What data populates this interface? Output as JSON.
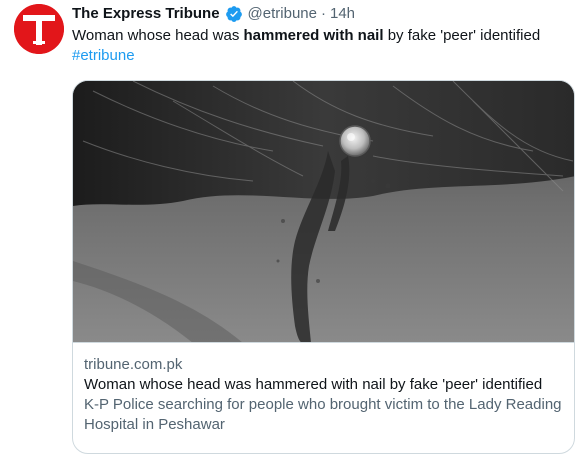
{
  "tweet": {
    "author": {
      "display_name": "The Express Tribune",
      "handle": "@etribune",
      "verified": true,
      "avatar_letter": "T",
      "avatar_color": "#e2161a"
    },
    "separator": "·",
    "time": "14h",
    "text": {
      "part1": "Woman whose head was ",
      "bold": "hammered with nail",
      "part2": " by fake 'peer' identified",
      "hashtag": "#etribune"
    },
    "card": {
      "image_description_icon": "photo",
      "domain": "tribune.com.pk",
      "title": "Woman whose head was hammered with nail by fake 'peer' identified",
      "description": "K-P Police searching for people who brought victim to the Lady Reading Hospital in Peshawar"
    }
  },
  "colors": {
    "text_primary": "#0f1419",
    "text_secondary": "#536471",
    "link": "#1d9bf0",
    "verified": "#1d9bf0",
    "border": "#cfd9de"
  }
}
